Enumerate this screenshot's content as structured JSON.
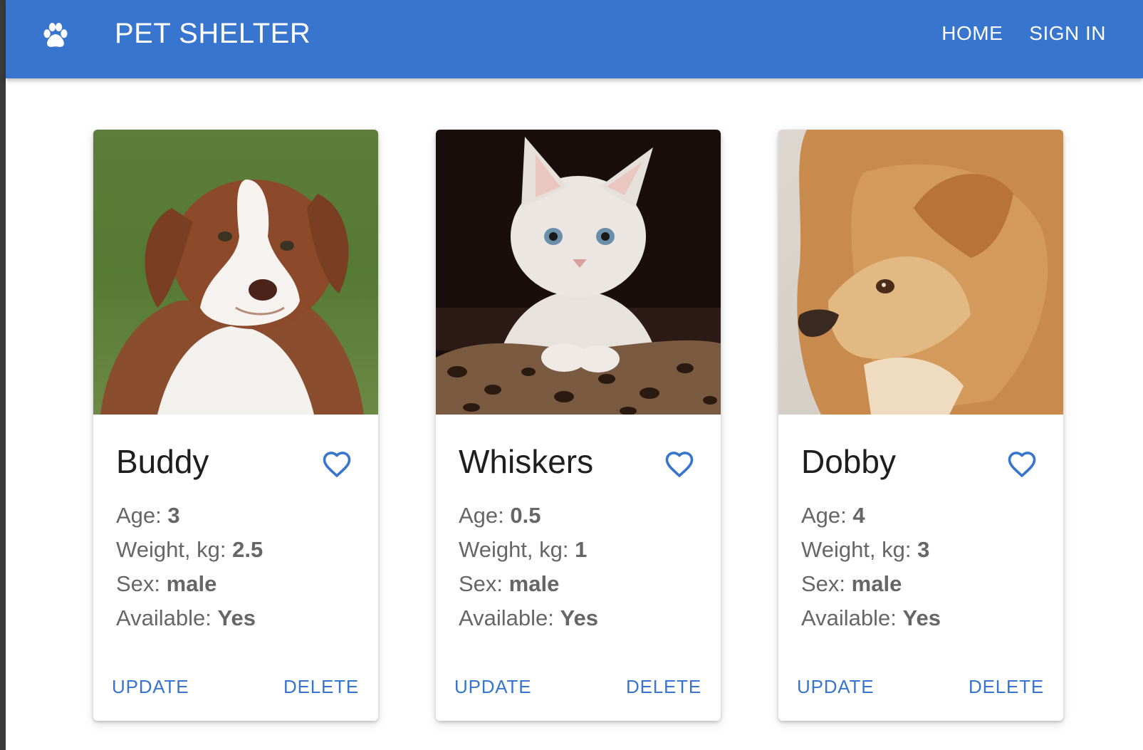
{
  "colors": {
    "primary": "#3875cf",
    "text_dark": "#1e1e1e",
    "text_muted": "#666666",
    "card_bg": "#ffffff"
  },
  "header": {
    "logo_icon": "paw-icon",
    "title": "PET SHELTER",
    "nav": {
      "home": "HOME",
      "sign_in": "SIGN IN"
    }
  },
  "pets": [
    {
      "name": "Buddy",
      "photo": "brown-white-puppy-photo",
      "favorite_icon": "heart-outline-icon",
      "age_label": "Age:",
      "age": "3",
      "weight_label": "Weight, kg:",
      "weight": "2.5",
      "sex_label": "Sex:",
      "sex": "male",
      "available_label": "Available:",
      "available": "Yes",
      "update_label": "UPDATE",
      "delete_label": "DELETE"
    },
    {
      "name": "Whiskers",
      "photo": "white-kitten-photo",
      "favorite_icon": "heart-outline-icon",
      "age_label": "Age:",
      "age": "0.5",
      "weight_label": "Weight, kg:",
      "weight": "1",
      "sex_label": "Sex:",
      "sex": "male",
      "available_label": "Available:",
      "available": "Yes",
      "update_label": "UPDATE",
      "delete_label": "DELETE"
    },
    {
      "name": "Dobby",
      "photo": "ginger-fluffy-dog-photo",
      "favorite_icon": "heart-outline-icon",
      "age_label": "Age:",
      "age": "4",
      "weight_label": "Weight, kg:",
      "weight": "3",
      "sex_label": "Sex:",
      "sex": "male",
      "available_label": "Available:",
      "available": "Yes",
      "update_label": "UPDATE",
      "delete_label": "DELETE"
    }
  ]
}
